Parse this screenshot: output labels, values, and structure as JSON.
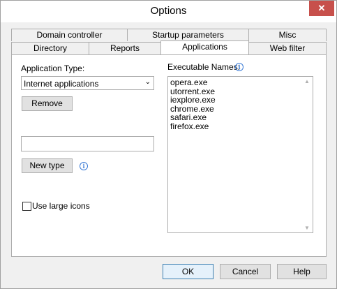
{
  "window": {
    "title": "Options",
    "close_icon": "close-icon"
  },
  "tabs_row1": [
    {
      "label": "Domain controller"
    },
    {
      "label": "Startup parameters"
    },
    {
      "label": "Misc"
    }
  ],
  "tabs_row2": [
    {
      "label": "Directory"
    },
    {
      "label": "Reports"
    },
    {
      "label": "Applications",
      "active": true
    },
    {
      "label": "Web filter"
    }
  ],
  "applications": {
    "app_type_label": "Application Type:",
    "app_type_value": "Internet applications",
    "remove_label": "Remove",
    "new_type_value": "",
    "new_type_label": "New type",
    "large_icons_label": "Use large icons",
    "large_icons_checked": false,
    "exe_label": "Executable Names:",
    "exe_names": [
      "opera.exe",
      "utorrent.exe",
      "iexplore.exe",
      "chrome.exe",
      "safari.exe",
      "firefox.exe"
    ]
  },
  "footer": {
    "ok_label": "OK",
    "cancel_label": "Cancel",
    "help_label": "Help"
  },
  "colors": {
    "close_button": "#c7504b",
    "info_icon": "#3b7bd6",
    "default_button_border": "#3c7fb1"
  }
}
